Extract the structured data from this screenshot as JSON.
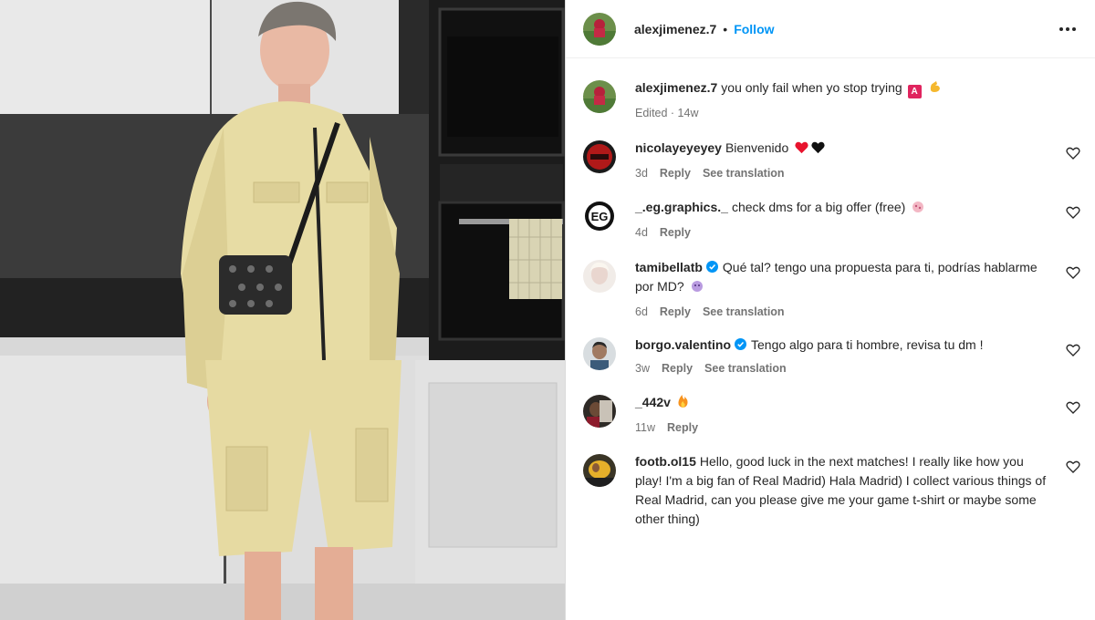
{
  "post": {
    "author": "alexjimenez.7",
    "separator": "•",
    "follow_label": "Follow",
    "caption": {
      "username": "alexjimenez.7",
      "text": "you only fail when yo stop trying",
      "badge": "A",
      "meta": "Edited · 14w"
    }
  },
  "comments": [
    {
      "username": "nicolayeyeyey",
      "text": "Bienvenido",
      "age": "3d",
      "reply": "Reply",
      "translate": "See translation",
      "verified": false,
      "emoji": "red-heart-black-heart"
    },
    {
      "username": "_.eg.graphics._",
      "text": "check dms for a big offer (free)",
      "age": "4d",
      "reply": "Reply",
      "translate": "",
      "verified": false,
      "emoji": "pink-blob"
    },
    {
      "username": "tamibellatb",
      "text": "Qué tal? tengo una propuesta para ti, podrías hablarme por MD?",
      "age": "6d",
      "reply": "Reply",
      "translate": "See translation",
      "verified": true,
      "emoji": "purple-face"
    },
    {
      "username": "borgo.valentino",
      "text": "Tengo algo para ti hombre, revisa tu dm !",
      "age": "3w",
      "reply": "Reply",
      "translate": "See translation",
      "verified": true,
      "emoji": ""
    },
    {
      "username": "_442v",
      "text": "",
      "age": "11w",
      "reply": "Reply",
      "translate": "",
      "verified": false,
      "emoji": "fire"
    },
    {
      "username": "footb.ol15",
      "text": "Hello, good luck in the next matches! I really like how you play! I'm a big fan of Real Madrid) Hala Madrid) I collect various things of Real Madrid, can you please give me your game t-shirt or maybe some other thing)",
      "age": "",
      "reply": "",
      "translate": "",
      "verified": false,
      "emoji": ""
    }
  ],
  "colors": {
    "follow": "#0095f6",
    "meta": "#737373",
    "text": "#262626",
    "verified": "#0095f6"
  }
}
